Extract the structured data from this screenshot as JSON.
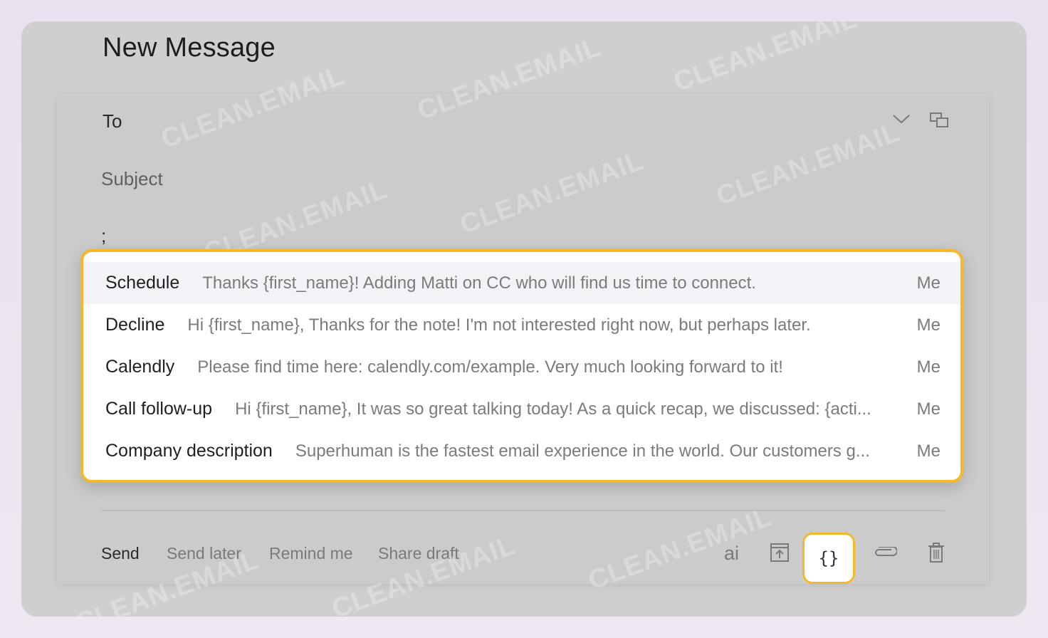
{
  "window": {
    "title": "New Message"
  },
  "fields": {
    "to_label": "To",
    "subject_placeholder": "Subject",
    "body_text": ";"
  },
  "snippets": [
    {
      "name": "Schedule",
      "text": "Thanks {first_name}! Adding Matti on CC who will find us time to connect.",
      "owner": "Me"
    },
    {
      "name": "Decline",
      "text": "Hi {first_name}, Thanks for the note! I'm not interested right now, but perhaps later.",
      "owner": "Me"
    },
    {
      "name": "Calendly",
      "text": "Please find time here: calendly.com/example. Very much looking forward to it!",
      "owner": "Me"
    },
    {
      "name": "Call follow-up",
      "text": "Hi {first_name}, It was so great talking today! As a quick recap, we discussed: {acti...",
      "owner": "Me"
    },
    {
      "name": "Company description",
      "text": "Superhuman is the fastest email experience in the world. Our customers g...",
      "owner": "Me"
    }
  ],
  "toolbar": {
    "send_label": "Send",
    "send_later_label": "Send later",
    "remind_label": "Remind me",
    "share_label": "Share draft",
    "ai_label": "ai",
    "snippet_label": "{}"
  },
  "watermark": "CLEAN.EMAIL",
  "colors": {
    "highlight": "#f4b829",
    "backdrop": "#cfcfcf"
  },
  "icons": [
    "chevron-down-icon",
    "popout-icon",
    "archive-icon",
    "paperclip-icon",
    "trash-icon"
  ]
}
